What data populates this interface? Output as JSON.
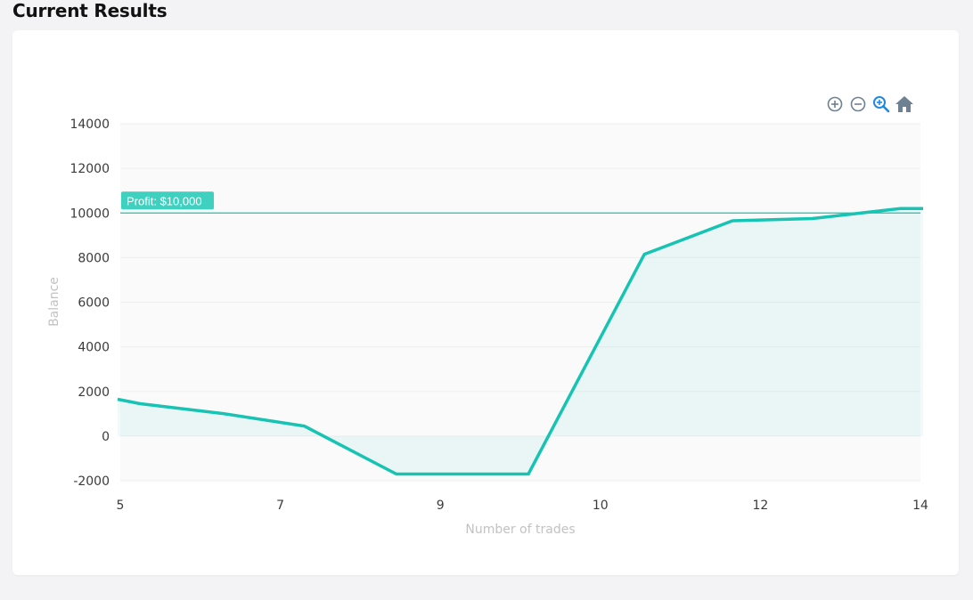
{
  "page": {
    "title": "Current Results"
  },
  "toolbar": {
    "zoom_in": "zoom-in-icon",
    "zoom_out": "zoom-out-icon",
    "zoom_select": "magnifier-zoom-icon",
    "reset": "home-icon"
  },
  "colors": {
    "series": "#17c3b2",
    "annotation": "#3fd0c0",
    "plot_bg": "#fafafa",
    "grid": "#efefef"
  },
  "chart_data": {
    "type": "area",
    "x": [
      5,
      5.25,
      6.3,
      7.3,
      8.45,
      9.55,
      10.55,
      11.65,
      12.65,
      13.75,
      14
    ],
    "series": [
      {
        "values": [
          1650,
          1450,
          1000,
          450,
          -1700,
          -1700,
          8150,
          9650,
          9750,
          10200,
          10200
        ]
      }
    ],
    "xticks": [
      "5",
      "7",
      "9",
      "10",
      "12",
      "14"
    ],
    "yticks": [
      "14000",
      "12000",
      "10000",
      "8000",
      "6000",
      "4000",
      "2000",
      "0",
      "-2000"
    ],
    "xlabel": "Number of trades",
    "ylabel": "Balance",
    "ylim": [
      -2000,
      14000
    ],
    "xlim": [
      5,
      14
    ],
    "grid": true,
    "annotation": {
      "y": 10000,
      "label": "Profit: $10,000"
    }
  }
}
